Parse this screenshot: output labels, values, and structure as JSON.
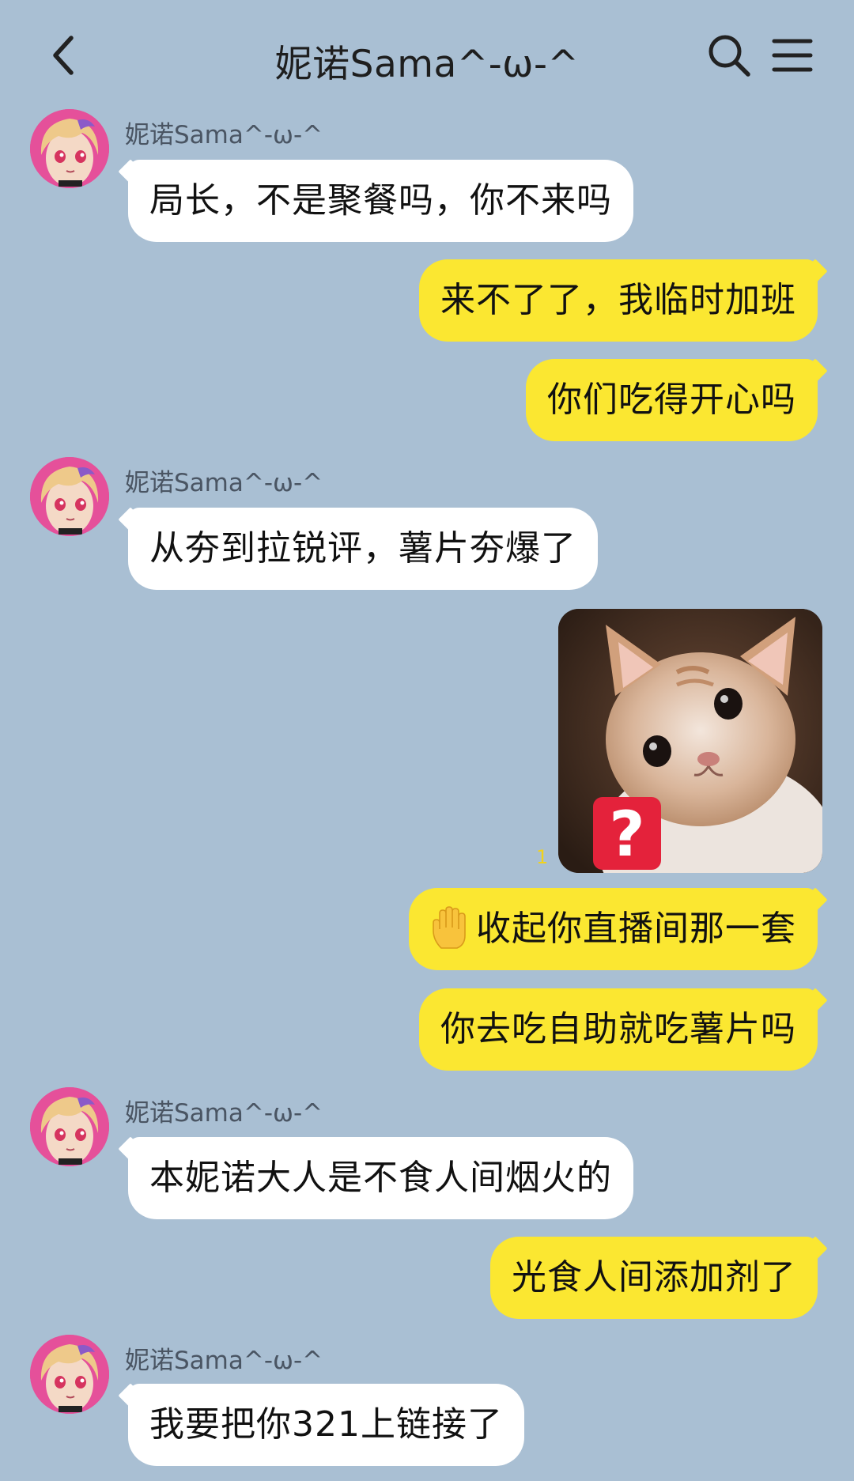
{
  "header": {
    "title": "妮诺Sama^-ω-^",
    "back_icon": "chevron-left-icon",
    "search_icon": "search-icon",
    "menu_icon": "menu-icon"
  },
  "colors": {
    "background": "#a9bfd3",
    "incoming_bubble": "#ffffff",
    "outgoing_bubble": "#fbe731",
    "read_count": "#f2d21a"
  },
  "messages": [
    {
      "side": "in",
      "sender": "妮诺Sama^-ω-^",
      "text": "局长，不是聚餐吗，你不来吗"
    },
    {
      "side": "out",
      "text": "来不了了，我临时加班"
    },
    {
      "side": "out",
      "text": "你们吃得开心吗"
    },
    {
      "side": "in",
      "sender": "妮诺Sama^-ω-^",
      "text": "从夯到拉锐评，薯片夯爆了"
    },
    {
      "side": "out",
      "type": "image",
      "image_icon": "crying-kitten-question-sticker",
      "read_count": "1"
    },
    {
      "side": "out",
      "emoji": "raised-hand-emoji",
      "text": "收起你直播间那一套"
    },
    {
      "side": "out",
      "text": "你去吃自助就吃薯片吗"
    },
    {
      "side": "in",
      "sender": "妮诺Sama^-ω-^",
      "text": "本妮诺大人是不食人间烟火的"
    },
    {
      "side": "out",
      "text": "光食人间添加剂了"
    },
    {
      "side": "in",
      "sender": "妮诺Sama^-ω-^",
      "text": "我要把你321上链接了"
    }
  ]
}
